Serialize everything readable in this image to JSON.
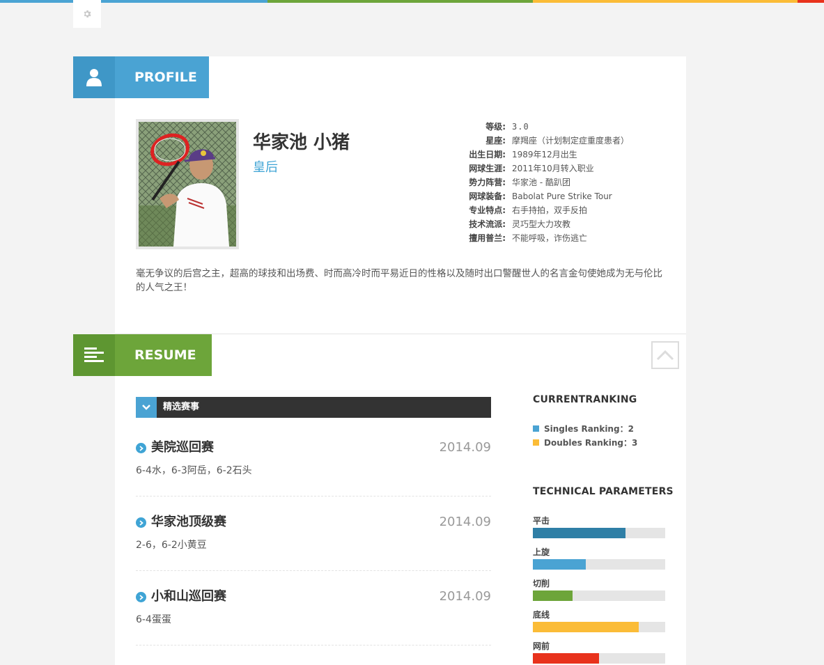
{
  "colors": {
    "top_bar": [
      "#4aa3d3",
      "#6da53a",
      "#fbbc37",
      "#e8321c"
    ],
    "profile_accent": "#4aa3d3",
    "resume_accent": "#6da53a"
  },
  "profile": {
    "section_label": "PROFILE",
    "name": "华家池 小猪",
    "alias": "皇后",
    "info": [
      {
        "k": "等级:",
        "v": "3.0"
      },
      {
        "k": "星座:",
        "v": "摩羯座（计划制定症重度患者）"
      },
      {
        "k": "出生日期:",
        "v": "1989年12月出生"
      },
      {
        "k": "网球生涯:",
        "v": "2011年10月转入职业"
      },
      {
        "k": "势力阵营:",
        "v": "华家池 - 酷趴团"
      },
      {
        "k": "网球装备:",
        "v": "Babolat Pure Strike Tour"
      },
      {
        "k": "专业特点:",
        "v": "右手持拍，双手反拍"
      },
      {
        "k": "技术流派:",
        "v": "灵巧型大力攻教"
      },
      {
        "k": "擅用普兰:",
        "v": "不能呼吸，诈伤逃亡"
      }
    ],
    "description": "毫无争议的后宫之主，超高的球技和出场费、时而高冷时而平易近日的性格以及随时出口警醒世人的名言金句使她成为无与伦比的人气之王！"
  },
  "resume": {
    "section_label": "RESUME",
    "events_header": "精选赛事",
    "events": [
      {
        "title": "美院巡回赛",
        "date": "2014.09",
        "result": "6-4水，6-3阿岳，6-2石头"
      },
      {
        "title": "华家池顶级赛",
        "date": "2014.09",
        "result": "2-6，6-2小黄豆"
      },
      {
        "title": "小和山巡回赛",
        "date": "2014.09",
        "result": "6-4蛋蛋"
      }
    ],
    "ranking": {
      "heading": "CURRENTRANKING",
      "items": [
        {
          "label": "Singles Ranking：2",
          "color": "#4aa3d3"
        },
        {
          "label": "Doubles Ranking：3",
          "color": "#fbbc37"
        }
      ]
    },
    "technical": {
      "heading": "TECHNICAL PARAMETERS",
      "params": [
        {
          "label": "平击",
          "level": 0.7,
          "color": "#2f7fa6"
        },
        {
          "label": "上旋",
          "level": 0.4,
          "color": "#4aa3d3"
        },
        {
          "label": "切削",
          "level": 0.3,
          "color": "#6da53a"
        },
        {
          "label": "底线",
          "level": 0.8,
          "color": "#fbbc37"
        },
        {
          "label": "网前",
          "level": 0.5,
          "color": "#e8321c"
        }
      ]
    }
  }
}
